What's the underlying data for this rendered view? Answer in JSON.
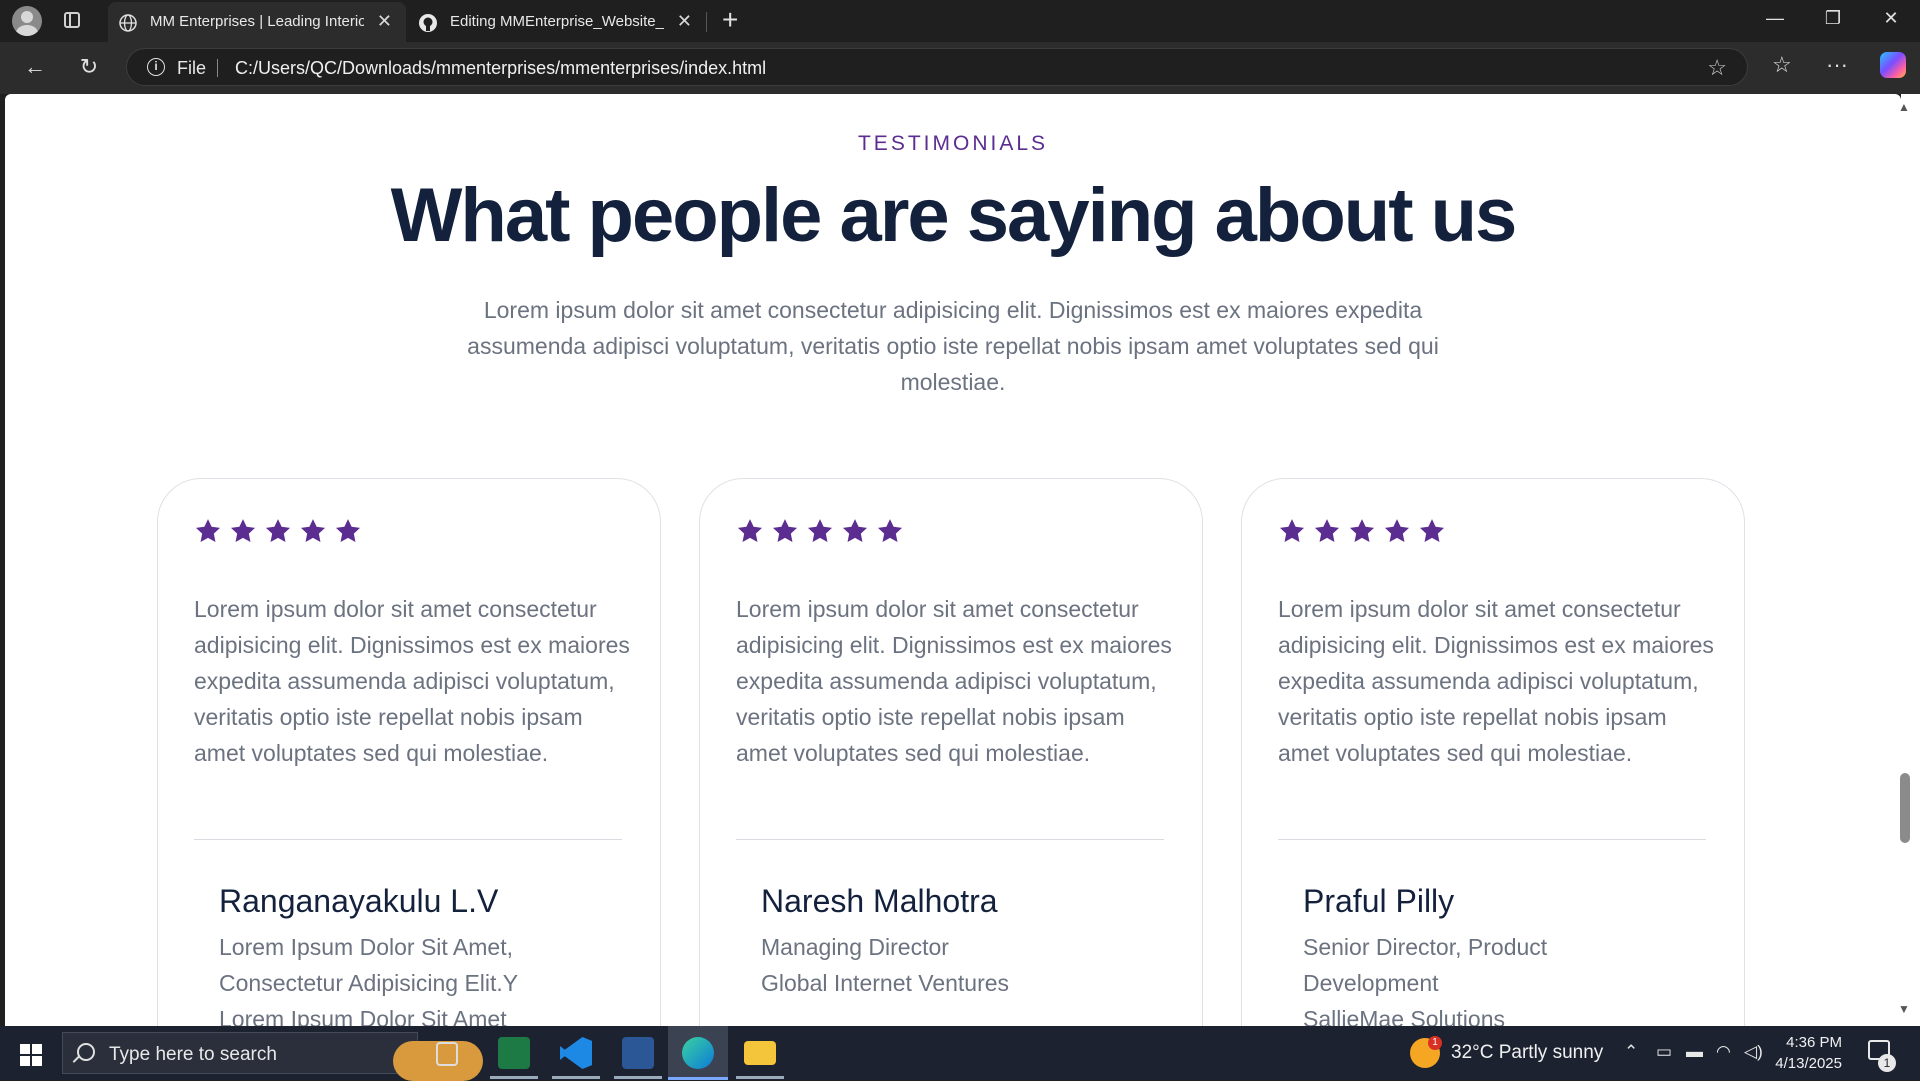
{
  "browser": {
    "tabs": [
      {
        "label": "MM Enterprises | Leading Interior",
        "icon": "globe-icon",
        "active": true
      },
      {
        "label": "Editing MMEnterprise_Website_pr",
        "icon": "github-icon",
        "active": false
      }
    ],
    "new_tab_label": "+",
    "window_controls": {
      "minimize": "—",
      "restore": "❐",
      "close": "✕"
    },
    "address": {
      "scheme_label": "File",
      "url": "C:/Users/QC/Downloads/mmenterprises/mmenterprises/index.html"
    },
    "icons": [
      "back-icon",
      "refresh-icon",
      "info-icon",
      "favorite-star-icon",
      "favorites-icon",
      "more-icon",
      "copilot-icon"
    ]
  },
  "page": {
    "eyebrow": "TESTIMONIALS",
    "headline": "What people are saying about us",
    "intro": "Lorem ipsum dolor sit amet consectetur adipisicing elit. Dignissimos est ex maiores expedita assumenda adipisci voluptatum, veritatis optio iste repellat nobis ipsam amet voluptates sed qui molestiae.",
    "accent_color": "#5c2d91",
    "testimonials": [
      {
        "rating": 5,
        "quote": "Lorem ipsum dolor sit amet consectetur adipisicing elit. Dignissimos est ex maiores expedita assumenda adipisci voluptatum, veritatis optio iste repellat nobis ipsam amet voluptates sed qui molestiae.",
        "name": "Ranganayakulu L.V",
        "role_lines": [
          "Lorem Ipsum Dolor Sit Amet,",
          "Consectetur Adipisicing Elit.Y",
          "Lorem Ipsum Dolor Sit Amet"
        ]
      },
      {
        "rating": 5,
        "quote": "Lorem ipsum dolor sit amet consectetur adipisicing elit. Dignissimos est ex maiores expedita assumenda adipisci voluptatum, veritatis optio iste repellat nobis ipsam amet voluptates sed qui molestiae.",
        "name": "Naresh Malhotra",
        "role_lines": [
          "Managing Director",
          "Global Internet Ventures"
        ]
      },
      {
        "rating": 5,
        "quote": "Lorem ipsum dolor sit amet consectetur adipisicing elit. Dignissimos est ex maiores expedita assumenda adipisci voluptatum, veritatis optio iste repellat nobis ipsam amet voluptates sed qui molestiae.",
        "name": "Praful Pilly",
        "role_lines": [
          "Senior Director, Product",
          "Development",
          "SallieMae Solutions"
        ]
      }
    ]
  },
  "taskbar": {
    "search_placeholder": "Type here to search",
    "weather": {
      "temp": "32°C",
      "condition": "Partly sunny",
      "badge": "1"
    },
    "time": "4:36 PM",
    "date": "4/13/2025",
    "notification_count": "1",
    "pinned_apps": [
      "task-view-icon",
      "excel-icon",
      "vscode-icon",
      "word-icon",
      "edge-icon",
      "file-explorer-icon"
    ]
  }
}
